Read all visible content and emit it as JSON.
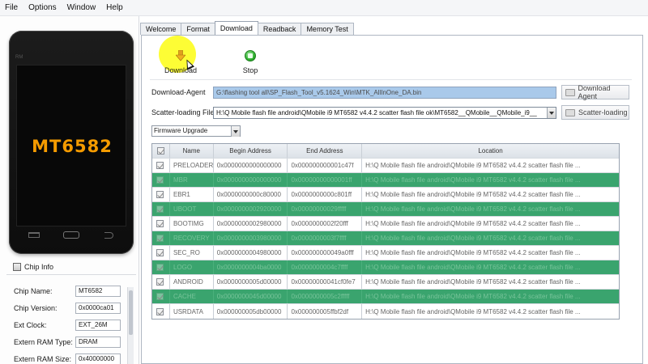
{
  "menu": [
    "File",
    "Options",
    "Window",
    "Help"
  ],
  "phone": {
    "chip_label": "MT6582",
    "small_text": "RM"
  },
  "chip_info": {
    "title": "Chip Info",
    "rows": [
      {
        "key": "Chip Name:",
        "value": "MT6582"
      },
      {
        "key": "Chip Version:",
        "value": "0x0000ca01"
      },
      {
        "key": "Ext Clock:",
        "value": "EXT_26M"
      },
      {
        "key": "Extern RAM Type:",
        "value": "DRAM"
      },
      {
        "key": "Extern RAM Size:",
        "value": "0x40000000"
      }
    ]
  },
  "tabs": [
    {
      "label": "Welcome",
      "active": false
    },
    {
      "label": "Format",
      "active": false
    },
    {
      "label": "Download",
      "active": true
    },
    {
      "label": "Readback",
      "active": false
    },
    {
      "label": "Memory Test",
      "active": false
    }
  ],
  "toolbar": {
    "download_label": "Download",
    "stop_label": "Stop"
  },
  "download_agent": {
    "label": "Download-Agent",
    "value": "G:\\flashing tool all\\SP_Flash_Tool_v5.1624_Win\\MTK_AllInOne_DA.bin",
    "button": "Download Agent"
  },
  "scatter": {
    "label": "Scatter-loading File",
    "value": "H:\\Q Mobile flash file android\\QMobile i9 MT6582 v4.4.2 scatter flash file ok\\MT6582__QMobile__QMobile_i9__",
    "button": "Scatter-loading"
  },
  "mode_select": "Firmware Upgrade",
  "table": {
    "headers": [
      "Name",
      "Begin Address",
      "End Address",
      "Location"
    ],
    "rows": [
      {
        "name": "PRELOADER",
        "begin": "0x0000000000000000",
        "end": "0x000000000001c47f",
        "location": "H:\\Q Mobile flash file android\\QMobile i9 MT6582 v4.4.2 scatter flash file ...",
        "style": "white"
      },
      {
        "name": "MBR",
        "begin": "0x0000000000000000",
        "end": "0x00000000000001ff",
        "location": "H:\\Q Mobile flash file android\\QMobile i9 MT6582 v4.4.2 scatter flash file ...",
        "style": "green"
      },
      {
        "name": "EBR1",
        "begin": "0x0000000000c80000",
        "end": "0x0000000000c801ff",
        "location": "H:\\Q Mobile flash file android\\QMobile i9 MT6582 v4.4.2 scatter flash file ...",
        "style": "white"
      },
      {
        "name": "UBOOT",
        "begin": "0x0000000002920000",
        "end": "0x00000000029fffff",
        "location": "H:\\Q Mobile flash file android\\QMobile i9 MT6582 v4.4.2 scatter flash file ...",
        "style": "green"
      },
      {
        "name": "BOOTIMG",
        "begin": "0x0000000002980000",
        "end": "0x0000000002f20fff",
        "location": "H:\\Q Mobile flash file android\\QMobile i9 MT6582 v4.4.2 scatter flash file ...",
        "style": "white"
      },
      {
        "name": "RECOVERY",
        "begin": "0x0000000003980000",
        "end": "0x0000000003f7ffff",
        "location": "H:\\Q Mobile flash file android\\QMobile i9 MT6582 v4.4.2 scatter flash file ...",
        "style": "green"
      },
      {
        "name": "SEC_RO",
        "begin": "0x0000000004980000",
        "end": "0x000000000049a0fff",
        "location": "H:\\Q Mobile flash file android\\QMobile i9 MT6582 v4.4.2 scatter flash file ...",
        "style": "white"
      },
      {
        "name": "LOGO",
        "begin": "0x0000000004ba0000",
        "end": "0x0000000004c7ffff",
        "location": "H:\\Q Mobile flash file android\\QMobile i9 MT6582 v4.4.2 scatter flash file ...",
        "style": "green"
      },
      {
        "name": "ANDROID",
        "begin": "0x0000000005d00000",
        "end": "0x00000000041cf0fe7",
        "location": "H:\\Q Mobile flash file android\\QMobile i9 MT6582 v4.4.2 scatter flash file ...",
        "style": "white"
      },
      {
        "name": "CACHE",
        "begin": "0x0000000045d00000",
        "end": "0x0000000005c2fffff",
        "location": "H:\\Q Mobile flash file android\\QMobile i9 MT6582 v4.4.2 scatter flash file ...",
        "style": "green"
      },
      {
        "name": "USRDATA",
        "begin": "0x000000005db00000",
        "end": "0x000000005ffbf2df",
        "location": "H:\\Q Mobile flash file android\\QMobile i9 MT6582 v4.4.2 scatter flash file ...",
        "style": "white"
      }
    ]
  },
  "colors": {
    "row_green": "#3aa46e",
    "highlight": "#fdfd35",
    "chip_label": "#f59b00",
    "agent_field_bg": "#a9c9ea"
  }
}
